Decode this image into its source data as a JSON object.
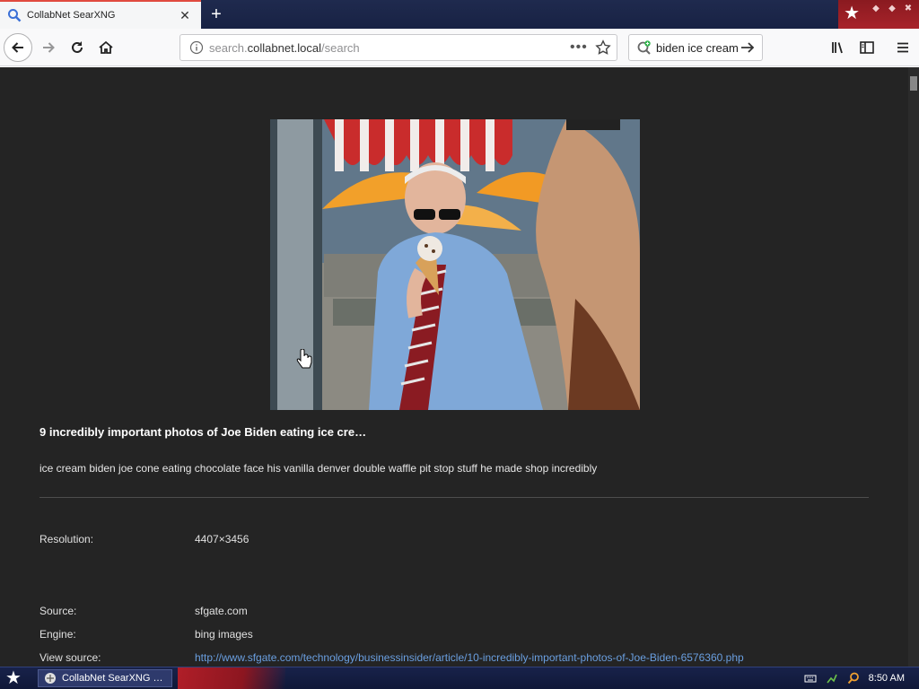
{
  "browser": {
    "tab": {
      "title": "CollabNet SearXNG"
    },
    "url": {
      "prefix": "search.",
      "host": "collabnet.local",
      "path": "/search"
    },
    "search": {
      "value": "biden ice cream"
    }
  },
  "result": {
    "title": "9 incredibly important photos of Joe Biden eating ice cre…",
    "description": "ice cream biden joe cone eating chocolate face his vanilla denver double waffle pit stop stuff he made shop incredibly",
    "resolution_label": "Resolution:",
    "resolution_value": "4407×3456",
    "source_label": "Source:",
    "source_value": "sfgate.com",
    "engine_label": "Engine:",
    "engine_value": "bing images",
    "view_source_label": "View source:",
    "view_source_value": "http://www.sfgate.com/technology/businessinsider/article/10-incredibly-important-photos-of-Joe-Biden-6576360.php"
  },
  "taskbar": {
    "task_label": "CollabNet SearXNG …",
    "clock": "8:50 AM"
  },
  "colors": {
    "content_bg": "#242424",
    "link": "#6a9fe0",
    "tab_accent": "#e04a3f"
  }
}
